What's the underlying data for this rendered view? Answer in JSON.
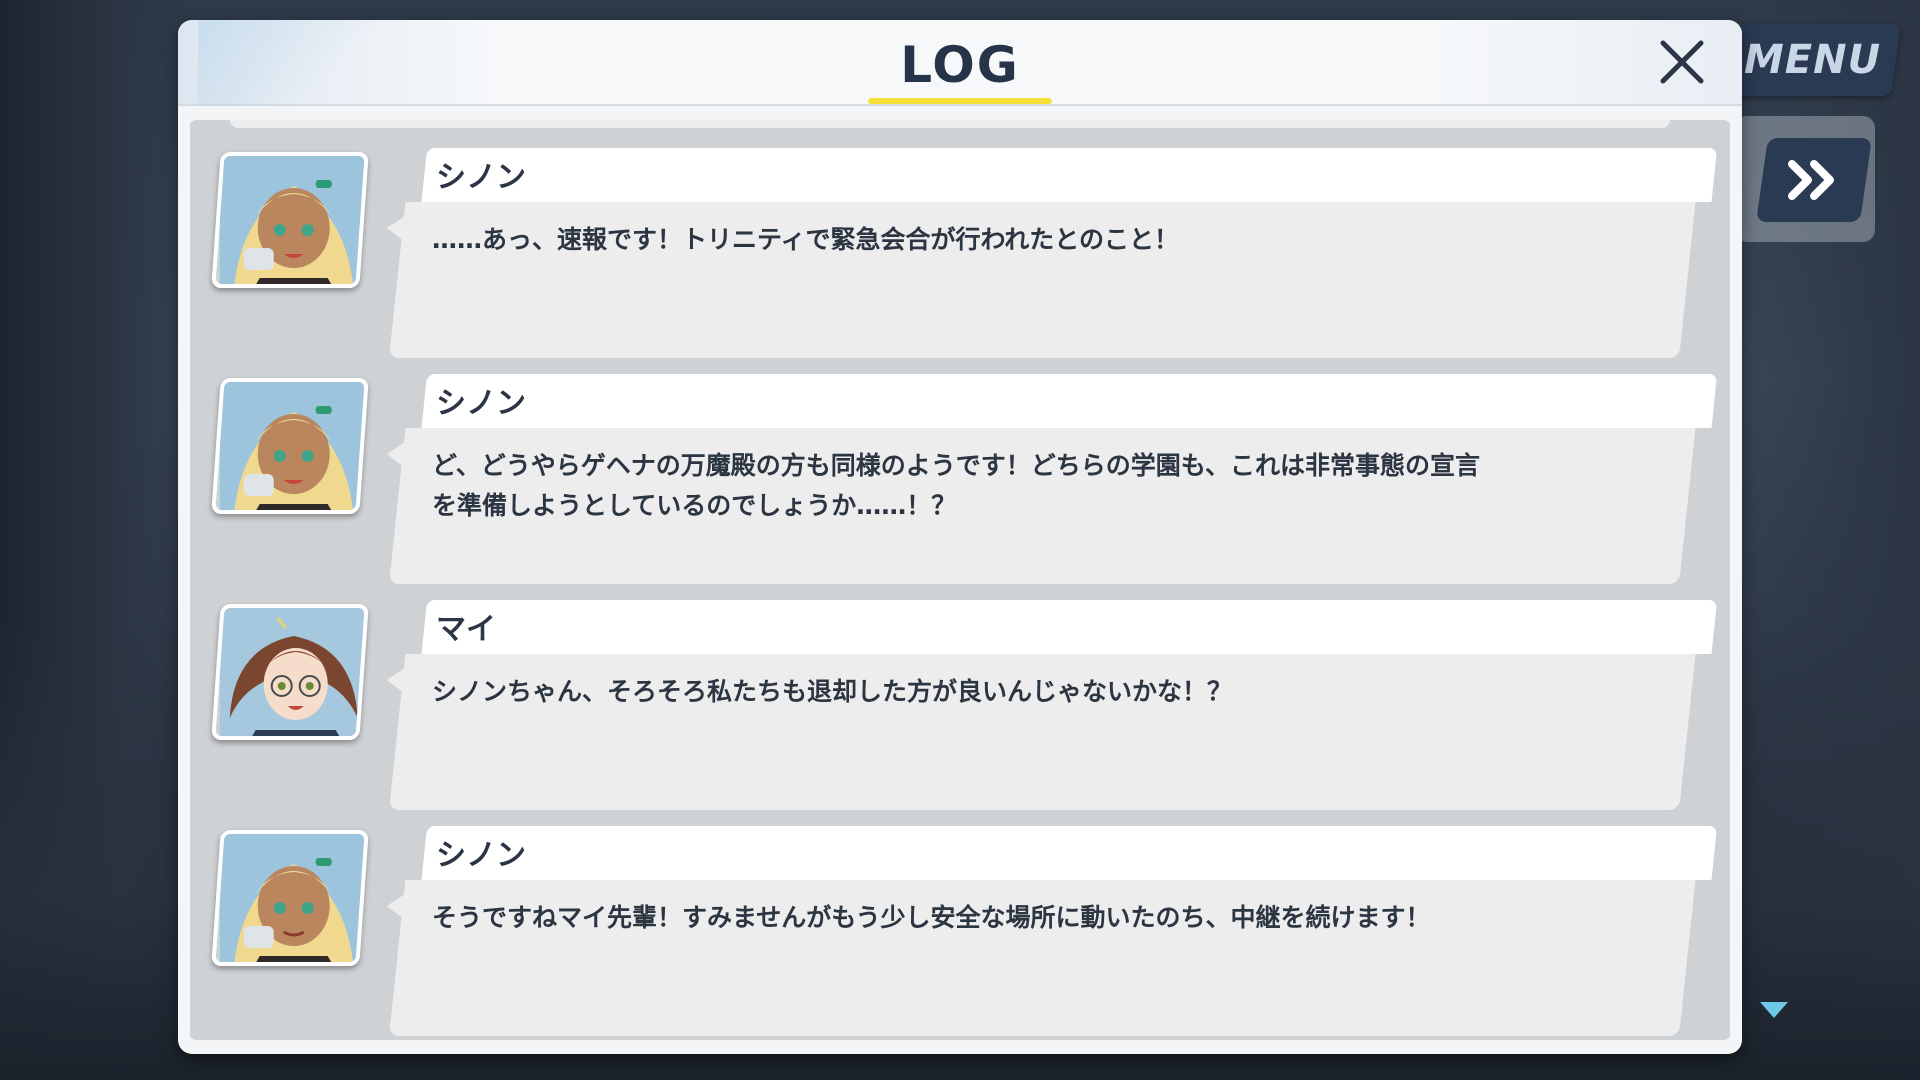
{
  "hud": {
    "menu_label": "MENU",
    "fast_forward_icon": "double-chevron-right-icon"
  },
  "log": {
    "title": "LOG",
    "close_icon": "close-icon",
    "accent_color": "#f5e13a",
    "entries": [
      {
        "speaker": "シノン",
        "portrait": "shinon-portrait",
        "text": "……あっ、速報です！トリニティで緊急会合が行われたとのこと！"
      },
      {
        "speaker": "シノン",
        "portrait": "shinon-portrait",
        "text": "ど、どうやらゲヘナの万魔殿の方も同様のようです！どちらの学園も、これは非常事態の宣言\nを準備しようとしているのでしょうか……！？"
      },
      {
        "speaker": "マイ",
        "portrait": "mai-portrait",
        "text": "シノンちゃん、そろそろ私たちも退却した方が良いんじゃないかな！？"
      },
      {
        "speaker": "シノン",
        "portrait": "shinon-portrait",
        "text": "そうですねマイ先輩！すみませんがもう少し安全な場所に動いたのち、中継を続けます！"
      }
    ]
  }
}
